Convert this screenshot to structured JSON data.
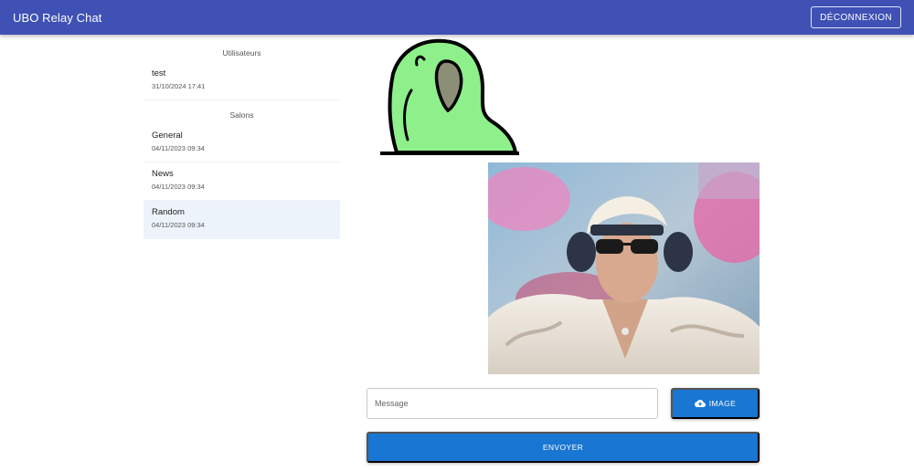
{
  "app": {
    "title": "UBO Relay Chat",
    "logout_label": "DÉCONNEXION"
  },
  "sidebar": {
    "users_header": "Utilisateurs",
    "users": [
      {
        "name": "test",
        "date": "31/10/2024 17:41"
      }
    ],
    "rooms_header": "Salons",
    "rooms": [
      {
        "name": "General",
        "date": "04/11/2023 09:34"
      },
      {
        "name": "News",
        "date": "04/11/2023 09:34"
      },
      {
        "name": "Random",
        "date": "04/11/2023 09:34",
        "selected": true
      }
    ]
  },
  "composer": {
    "message_placeholder": "Message",
    "image_button_label": "IMAGE",
    "send_button_label": "ENVOYER"
  },
  "colors": {
    "appbar": "#3f51b5",
    "primary_button": "#1976d2",
    "selected_item": "#edf3fb",
    "parrot_green": "#8ef08a"
  }
}
